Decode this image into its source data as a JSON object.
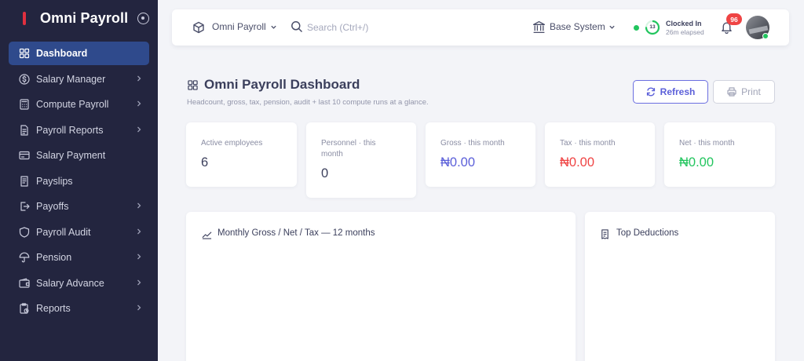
{
  "brand": {
    "name": "Omni Payroll",
    "logo_color": "#e0303f"
  },
  "sidebar": {
    "items": [
      {
        "label": "Dashboard",
        "icon": "dashboard-icon",
        "active": true,
        "has_submenu": false
      },
      {
        "label": "Salary Manager",
        "icon": "dollar-circle-icon",
        "active": false,
        "has_submenu": true
      },
      {
        "label": "Compute Payroll",
        "icon": "calculator-icon",
        "active": false,
        "has_submenu": true
      },
      {
        "label": "Payroll Reports",
        "icon": "document-icon",
        "active": false,
        "has_submenu": true
      },
      {
        "label": "Salary Payment",
        "icon": "credit-card-icon",
        "active": false,
        "has_submenu": false
      },
      {
        "label": "Payslips",
        "icon": "payslip-icon",
        "active": false,
        "has_submenu": false
      },
      {
        "label": "Payoffs",
        "icon": "export-icon",
        "active": false,
        "has_submenu": true
      },
      {
        "label": "Payroll Audit",
        "icon": "shield-icon",
        "active": false,
        "has_submenu": true
      },
      {
        "label": "Pension",
        "icon": "umbrella-icon",
        "active": false,
        "has_submenu": true
      },
      {
        "label": "Salary Advance",
        "icon": "wallet-icon",
        "active": false,
        "has_submenu": true
      },
      {
        "label": "Reports",
        "icon": "clipboard-icon",
        "active": false,
        "has_submenu": true
      }
    ]
  },
  "topbar": {
    "app_switcher": "Omni Payroll",
    "search_placeholder": "Search (Ctrl+/)",
    "company": "Base System",
    "clock": {
      "status": "Clocked In",
      "elapsed": "26m elapsed",
      "ring_value": "13"
    },
    "notifications_count": "96"
  },
  "page": {
    "title": "Omni Payroll Dashboard",
    "subtitle": "Headcount, gross, tax, pension, audit + last 10 compute runs at a glance.",
    "refresh_label": "Refresh",
    "print_label": "Print"
  },
  "stats": [
    {
      "label": "Active employees",
      "value": "6",
      "color": "#3b3f5c"
    },
    {
      "label": "Personnel · this month",
      "value": "0",
      "color": "#3b3f5c"
    },
    {
      "label": "Gross · this month",
      "value": "₦0.00",
      "color": "#5b5fd9"
    },
    {
      "label": "Tax · this month",
      "value": "₦0.00",
      "color": "#ef4444"
    },
    {
      "label": "Net · this month",
      "value": "₦0.00",
      "color": "#22c55e"
    }
  ],
  "panels": {
    "chart_title": "Monthly Gross / Net / Tax — 12 months",
    "deductions_title": "Top Deductions"
  },
  "colors": {
    "accent": "#5b5fd9",
    "sidebar_bg": "#23253f",
    "active_item": "#2f4a8c"
  }
}
